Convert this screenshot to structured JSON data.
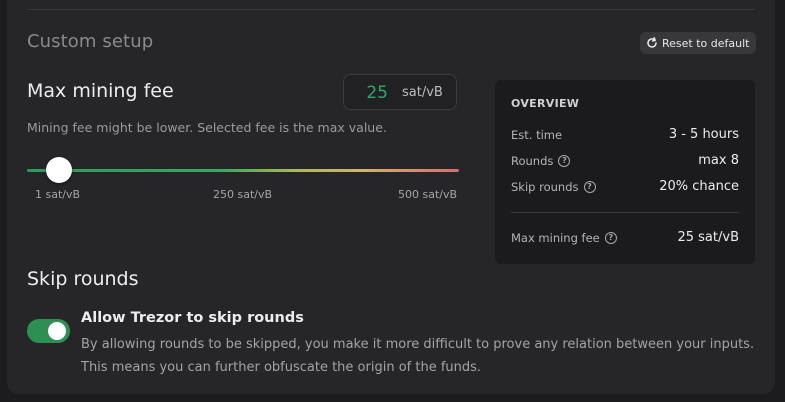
{
  "custom_setup": {
    "title": "Custom setup",
    "reset_label": "Reset to default"
  },
  "max_fee": {
    "title": "Max mining fee",
    "value": "25",
    "unit": "sat/vB",
    "hint": "Mining fee might be lower. Selected fee is the max value.",
    "slider": {
      "min_label": "1 sat/vB",
      "mid_label": "250 sat/vB",
      "max_label": "500 sat/vB",
      "min": 1,
      "max": 500,
      "current": 25
    }
  },
  "overview": {
    "title": "OVERVIEW",
    "rows": [
      {
        "label": "Est. time",
        "value": "3 - 5 hours"
      },
      {
        "label": "Rounds",
        "value": "max 8"
      },
      {
        "label": "Skip rounds",
        "value": "20% chance"
      }
    ],
    "fee_row": {
      "label": "Max mining fee",
      "value": "25 sat/vB"
    }
  },
  "skip_rounds": {
    "title": "Skip rounds",
    "toggle_on": true,
    "label": "Allow Trezor to skip rounds",
    "description": "By allowing rounds to be skipped, you make it more difficult to prove any relation between your inputs. This means you can further obfuscate the origin of the funds."
  },
  "colors": {
    "accent_green": "#2e8f53",
    "fee_value_green": "#2fa86a",
    "card_bg": "#262628",
    "overview_bg": "#1b1b1d"
  },
  "icons": {
    "reset": "refresh-icon",
    "help": "question-circle-icon"
  }
}
